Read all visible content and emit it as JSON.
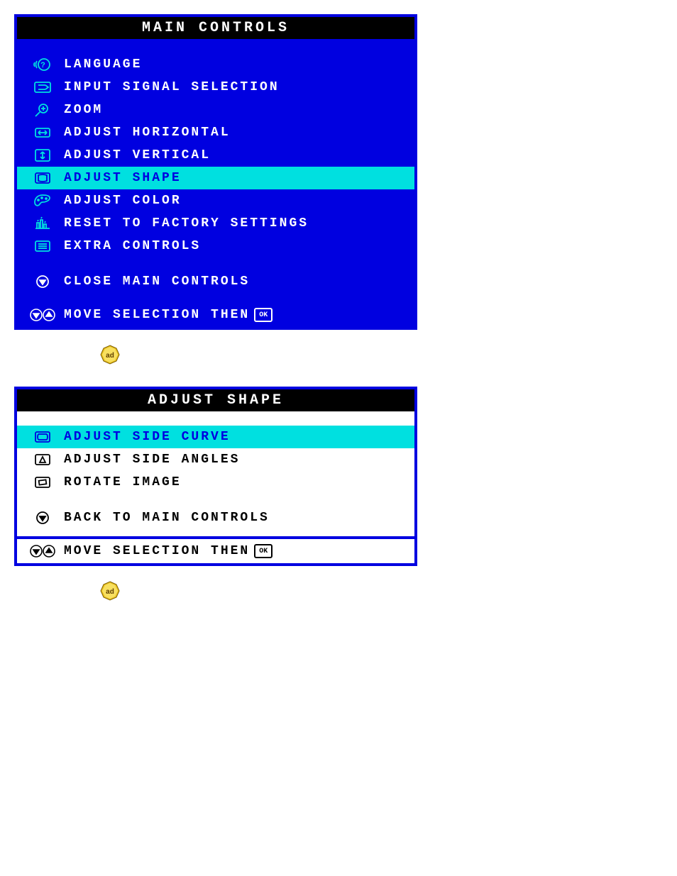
{
  "main": {
    "title": "MAIN CONTROLS",
    "items": [
      {
        "label": "LANGUAGE",
        "selected": false
      },
      {
        "label": "INPUT SIGNAL SELECTION",
        "selected": false
      },
      {
        "label": "ZOOM",
        "selected": false
      },
      {
        "label": "ADJUST HORIZONTAL",
        "selected": false
      },
      {
        "label": "ADJUST VERTICAL",
        "selected": false
      },
      {
        "label": "ADJUST SHAPE",
        "selected": true
      },
      {
        "label": "ADJUST COLOR",
        "selected": false
      },
      {
        "label": "RESET TO FACTORY SETTINGS",
        "selected": false
      },
      {
        "label": "EXTRA CONTROLS",
        "selected": false
      }
    ],
    "close_label": "CLOSE MAIN CONTROLS",
    "footer": "MOVE SELECTION THEN",
    "ok": "OK"
  },
  "shape": {
    "title": "ADJUST SHAPE",
    "items": [
      {
        "label": "ADJUST SIDE CURVE",
        "selected": true
      },
      {
        "label": "ADJUST SIDE ANGLES",
        "selected": false
      },
      {
        "label": "ROTATE IMAGE",
        "selected": false
      }
    ],
    "back_label": "BACK TO MAIN CONTROLS",
    "footer": "MOVE SELECTION THEN",
    "ok": "OK"
  }
}
